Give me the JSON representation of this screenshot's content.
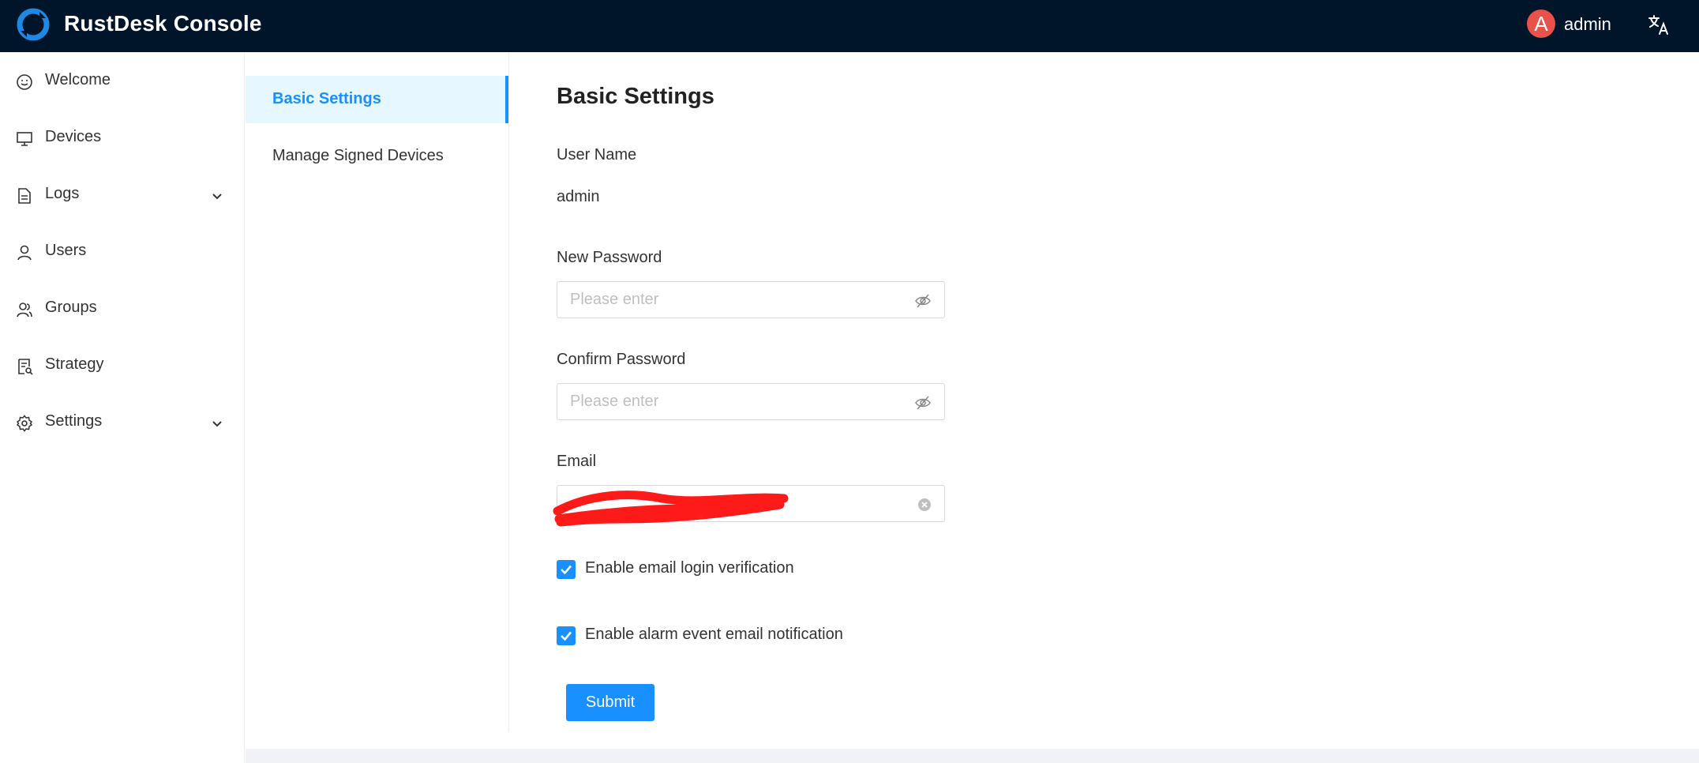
{
  "app": {
    "title": "RustDesk Console"
  },
  "header": {
    "avatar_letter": "A",
    "user_name": "admin"
  },
  "sidebar": {
    "items": [
      {
        "label": "Welcome",
        "icon": "smile-icon"
      },
      {
        "label": "Devices",
        "icon": "desktop-icon"
      },
      {
        "label": "Logs",
        "icon": "file-text-icon",
        "has_submenu": true
      },
      {
        "label": "Users",
        "icon": "user-icon"
      },
      {
        "label": "Groups",
        "icon": "team-icon"
      },
      {
        "label": "Strategy",
        "icon": "audit-icon"
      },
      {
        "label": "Settings",
        "icon": "gear-icon",
        "has_submenu": true
      }
    ]
  },
  "settings_menu": {
    "items": [
      {
        "label": "Basic Settings",
        "active": true
      },
      {
        "label": "Manage Signed Devices",
        "active": false
      }
    ]
  },
  "form": {
    "title": "Basic Settings",
    "user_name_label": "User Name",
    "user_name_value": "admin",
    "new_password_label": "New Password",
    "new_password_placeholder": "Please enter",
    "confirm_password_label": "Confirm Password",
    "confirm_password_placeholder": "Please enter",
    "email_label": "Email",
    "email_value": "",
    "checkbox_email_login": {
      "label": "Enable email login verification",
      "checked": true
    },
    "checkbox_alarm_notification": {
      "label": "Enable alarm event email notification",
      "checked": true
    },
    "submit_label": "Submit"
  },
  "colors": {
    "header_bg": "#001529",
    "accent": "#1890ff",
    "active_menu_bg": "#e6f7ff",
    "avatar_bg": "#e8524a",
    "redaction": "#ff0000"
  }
}
